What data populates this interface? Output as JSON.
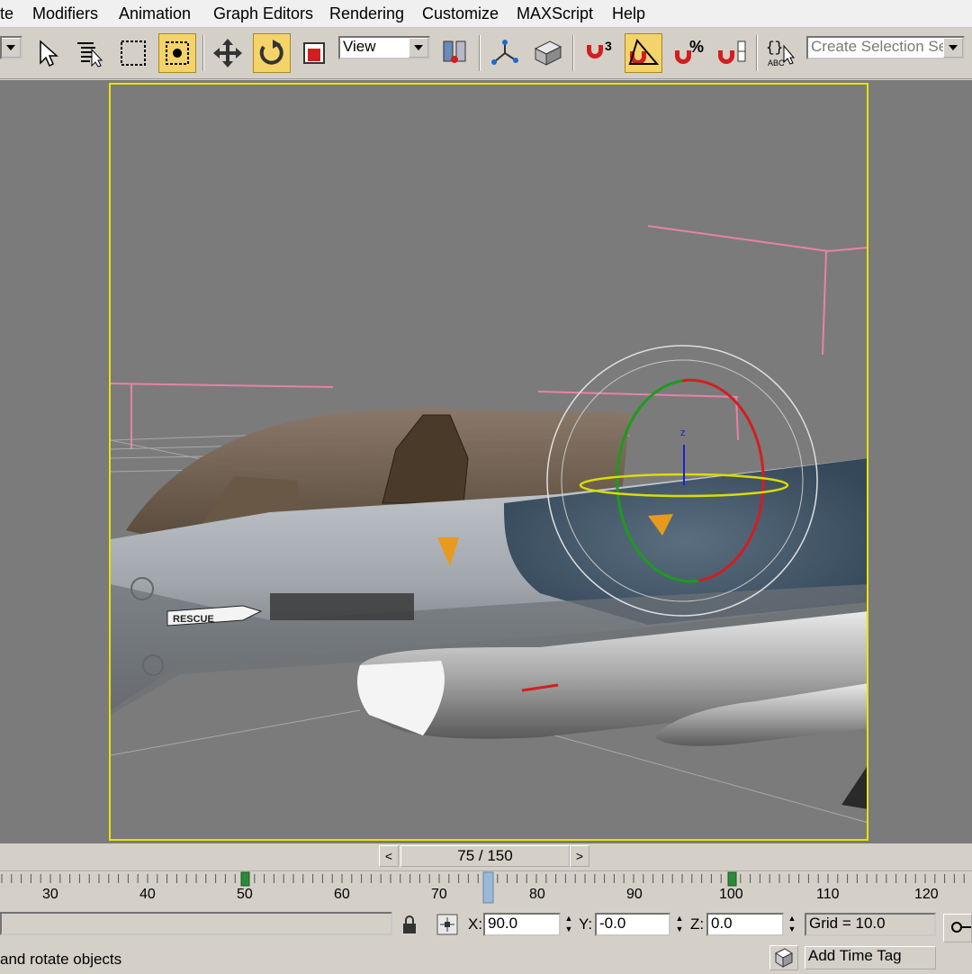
{
  "menu": {
    "items": [
      "te",
      "Modifiers",
      "Animation",
      "Graph Editors",
      "Rendering",
      "Customize",
      "MAXScript",
      "Help"
    ]
  },
  "toolbar": {
    "view_dropdown": "View",
    "selection_set_placeholder": "Create Selection Set",
    "icons": [
      "select-object-icon",
      "select-by-name-icon",
      "rectangular-selection-icon",
      "window-crossing-icon",
      "move-icon",
      "rotate-icon",
      "scale-icon",
      "use-pivot-center-icon",
      "select-manipulate-icon",
      "keyboard-shortcut-icon",
      "snaps-toggle-icon",
      "angle-snap-icon",
      "percent-snap-icon",
      "spinner-snap-icon",
      "named-selection-icon"
    ]
  },
  "viewport": {
    "labels": {
      "rescue": "RESCUE",
      "gizmo_axis": "z"
    },
    "colors": {
      "background": "#7b7b7b",
      "active_border": "#e8e300",
      "helper_lines": "#e882a8",
      "gizmo_x": "#d21e1e",
      "gizmo_y": "#1e9a1e",
      "gizmo_z": "#1e1ed2",
      "gizmo_view": "#dcdc00"
    }
  },
  "timeline": {
    "frame_display": "75 / 150",
    "prev_arrow": "<",
    "next_arrow": ">",
    "tick_labels": [
      "30",
      "40",
      "50",
      "60",
      "70",
      "80",
      "90",
      "100",
      "110",
      "120"
    ]
  },
  "status": {
    "x_label": "X:",
    "x_value": "90.0",
    "y_label": "Y:",
    "y_value": "-0.0",
    "z_label": "Z:",
    "z_value": "0.0",
    "grid": "Grid = 10.0",
    "prompt": "and rotate objects",
    "add_time_tag": "Add Time Tag"
  }
}
